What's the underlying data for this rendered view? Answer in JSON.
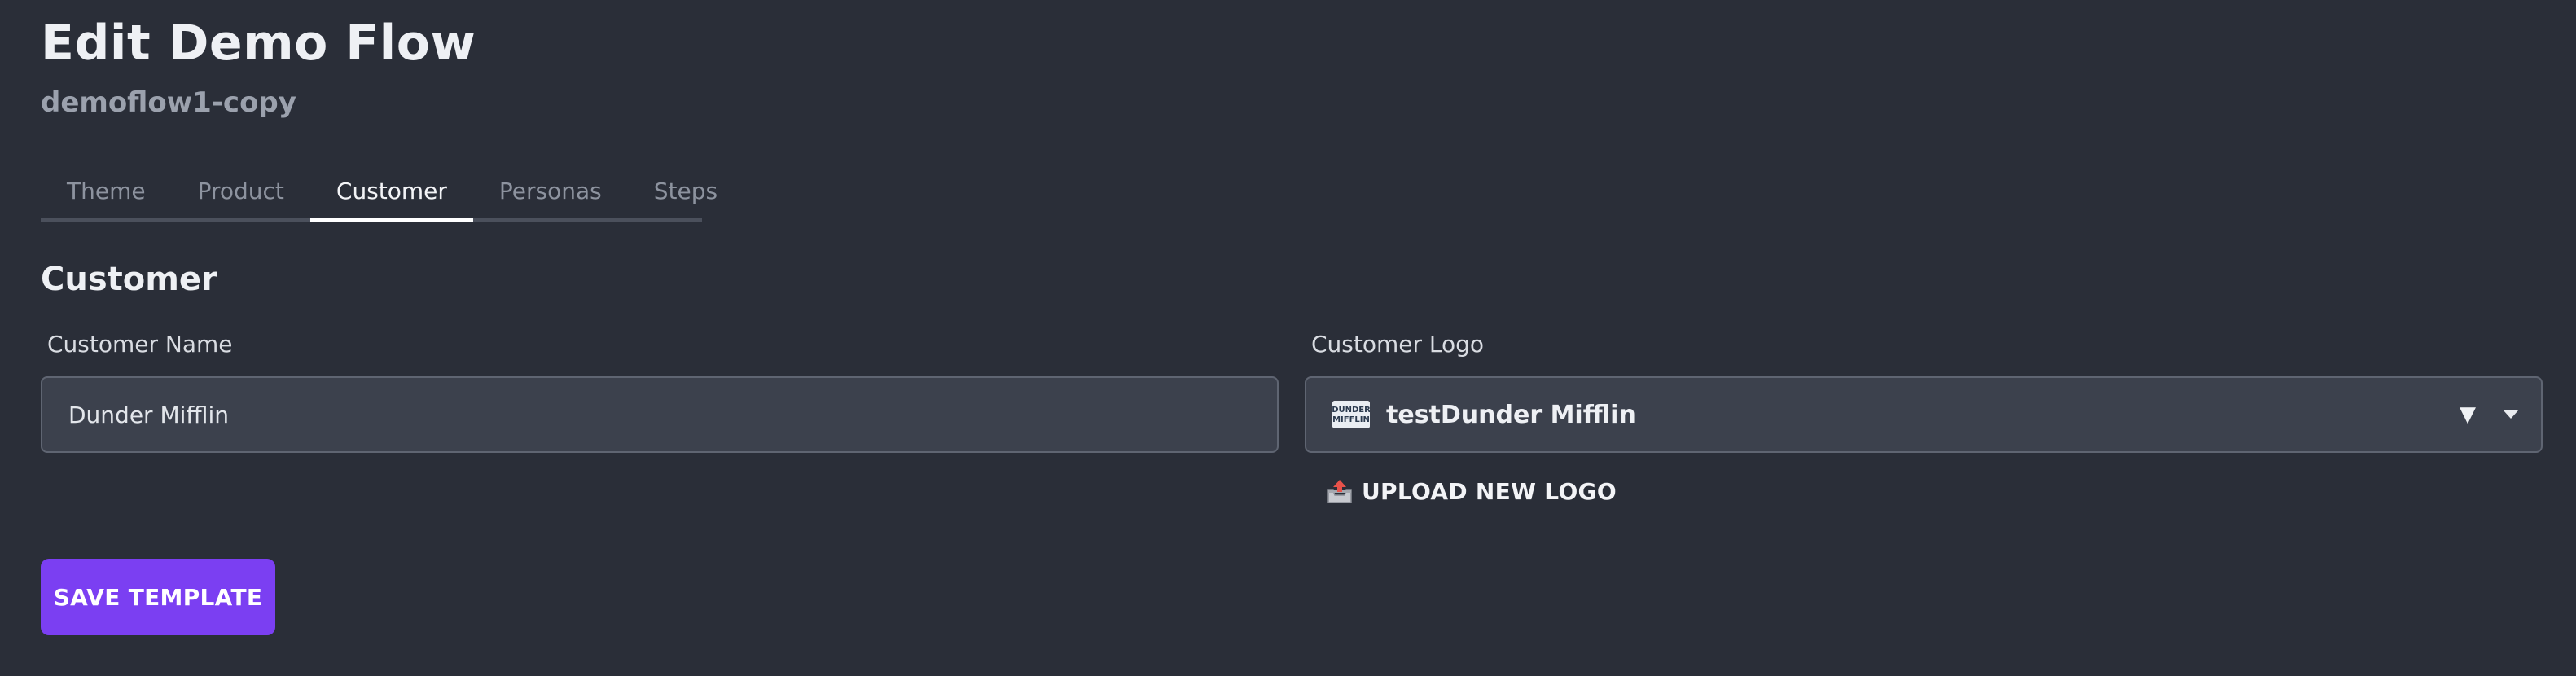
{
  "header": {
    "title": "Edit Demo Flow",
    "subtitle": "demoflow1-copy"
  },
  "tabs": [
    {
      "label": "Theme",
      "active": false
    },
    {
      "label": "Product",
      "active": false
    },
    {
      "label": "Customer",
      "active": true
    },
    {
      "label": "Personas",
      "active": false
    },
    {
      "label": "Steps",
      "active": false
    }
  ],
  "section": {
    "heading": "Customer"
  },
  "form": {
    "customer_name": {
      "label": "Customer Name",
      "value": "Dunder Mifflin"
    },
    "customer_logo": {
      "label": "Customer Logo",
      "selected": "testDunder Mifflin",
      "logo_text_line1": "DUNDER",
      "logo_text_line2": "MIFFLIN",
      "triangle_glyph": "▼"
    },
    "upload_label": "UPLOAD NEW LOGO"
  },
  "actions": {
    "save_label": "SAVE TEMPLATE"
  },
  "colors": {
    "background": "#2a2e38",
    "input_bg": "#3c414d",
    "accent": "#7b3ff2",
    "tab_inactive": "#8d939f"
  },
  "icons": {
    "upload": "outbox-tray-icon",
    "logo": "dunder-mifflin-logo",
    "dropdown": "chevron-down-icon"
  }
}
